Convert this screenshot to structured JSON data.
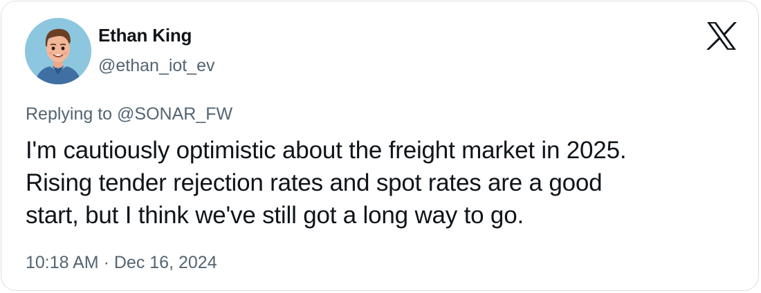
{
  "author": {
    "display_name": "Ethan King",
    "handle": "@ethan_iot_ev"
  },
  "platform_icon": "x-logo-icon",
  "reply": {
    "prefix": "Replying to",
    "target": "@SONAR_FW"
  },
  "tweet": {
    "lines": [
      "I'm cautiously optimistic about the freight market in 2025.",
      "Rising tender rejection rates and spot rates are a good",
      "start, but I think we've still got a long way to go."
    ]
  },
  "meta": {
    "time": "10:18 AM",
    "separator": "·",
    "date": "Dec 16, 2024"
  },
  "colors": {
    "text_primary": "#0f1419",
    "text_secondary": "#536471",
    "border": "#d9dee2",
    "avatar_background": "#8cc6df"
  }
}
